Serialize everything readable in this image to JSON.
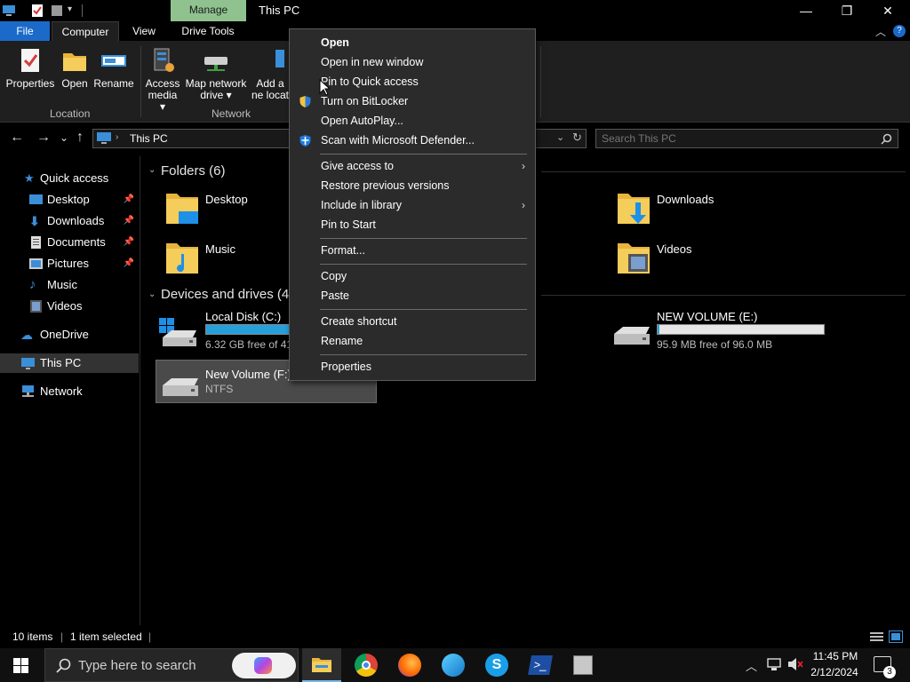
{
  "window": {
    "manage_tab": "Manage",
    "title": "This PC",
    "minimize": "—",
    "maximize": "❐",
    "close": "✕"
  },
  "ribbon_tabs": {
    "file": "File",
    "computer": "Computer",
    "view": "View",
    "drive_tools": "Drive Tools"
  },
  "ribbon": {
    "properties": "Properties",
    "open": "Open",
    "rename": "Rename",
    "access_media": "Access media ▾",
    "map_network_drive": "Map network drive ▾",
    "add_network_location": "Add a ne locat",
    "group_location": "Location",
    "group_network": "Network"
  },
  "nav": {
    "back": "←",
    "forward": "→",
    "dropdown": "⌄",
    "up": "↑",
    "path": "This PC",
    "search_placeholder": "Search This PC"
  },
  "navpane": {
    "quick_access": "Quick access",
    "desktop": "Desktop",
    "downloads": "Downloads",
    "documents": "Documents",
    "pictures": "Pictures",
    "music": "Music",
    "videos": "Videos",
    "onedrive": "OneDrive",
    "this_pc": "This PC",
    "network": "Network"
  },
  "content": {
    "folders_header": "Folders (6)",
    "devices_header": "Devices and drives (4)",
    "folders": {
      "desktop": "Desktop",
      "downloads": "Downloads",
      "music": "Music",
      "videos": "Videos"
    },
    "drives": {
      "c_name": "Local Disk (C:)",
      "c_free": "6.32 GB free of 41.",
      "c_used_fraction": 0.85,
      "e_name": "NEW VOLUME (E:)",
      "e_free": "95.9 MB free of 96.0 MB",
      "e_used_fraction": 0.01,
      "f_name": "New Volume (F:)",
      "f_fs": "NTFS"
    }
  },
  "context_menu": {
    "open": "Open",
    "open_new_window": "Open in new window",
    "pin_quick_access": "Pin to Quick access",
    "bitlocker": "Turn on BitLocker",
    "autoplay": "Open AutoPlay...",
    "defender": "Scan with Microsoft Defender...",
    "give_access": "Give access to",
    "restore_versions": "Restore previous versions",
    "include_library": "Include in library",
    "pin_start": "Pin to Start",
    "format": "Format...",
    "copy": "Copy",
    "paste": "Paste",
    "create_shortcut": "Create shortcut",
    "rename": "Rename",
    "properties": "Properties"
  },
  "status": {
    "items": "10 items",
    "selected": "1 item selected"
  },
  "taskbar": {
    "search_placeholder": "Type here to search",
    "time": "11:45 PM",
    "date": "2/12/2024",
    "notifications": "3"
  }
}
